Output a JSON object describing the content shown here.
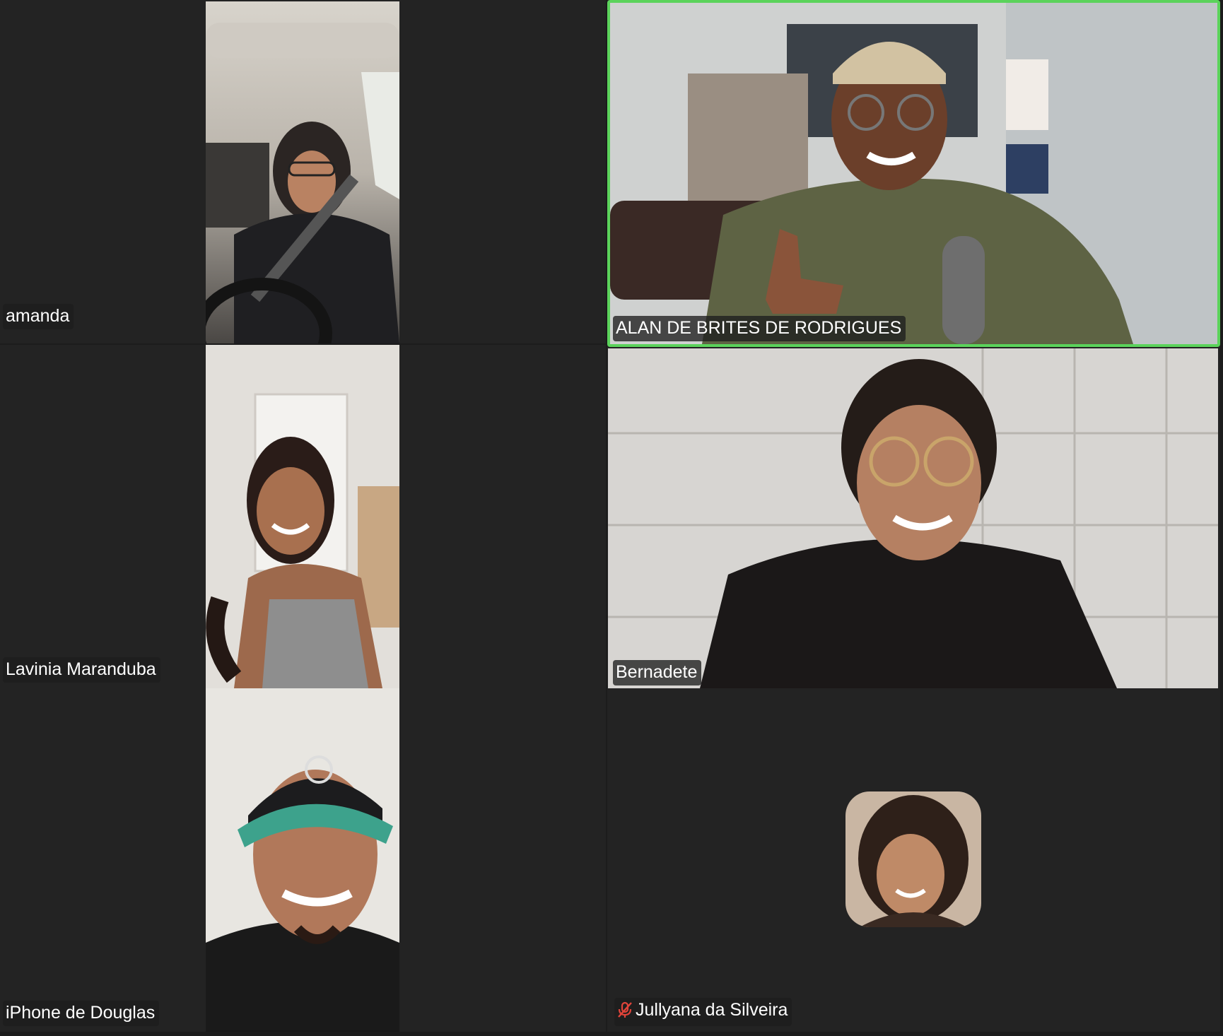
{
  "meeting": {
    "participants": [
      {
        "name": "amanda"
      },
      {
        "name": "ALAN DE BRITES DE RODRIGUES"
      },
      {
        "name": "Lavinia Maranduba"
      },
      {
        "name": "Bernadete"
      },
      {
        "name": "iPhone de Douglas"
      },
      {
        "name": "Jullyana da Silveira"
      }
    ]
  },
  "colors": {
    "active_speaker_border": "#5bd35b",
    "tile_background": "#232323",
    "muted_icon": "#e0443a"
  },
  "icons": {
    "muted": "microphone-muted-icon"
  }
}
